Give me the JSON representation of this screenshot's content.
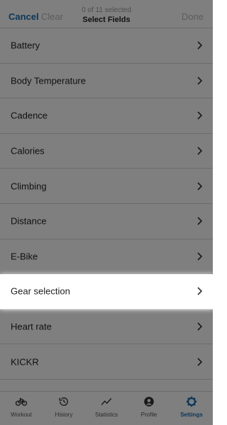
{
  "header": {
    "cancel_label": "Cancel",
    "clear_label": "Clear",
    "selected_count": "0 of 11 selected",
    "title": "Select Fields",
    "done_label": "Done"
  },
  "fields": [
    {
      "label": "Battery"
    },
    {
      "label": "Body Temperature"
    },
    {
      "label": "Cadence"
    },
    {
      "label": "Calories"
    },
    {
      "label": "Climbing"
    },
    {
      "label": "Distance"
    },
    {
      "label": "E-Bike"
    },
    {
      "label": "Gear selection"
    },
    {
      "label": "Heart rate"
    },
    {
      "label": "KICKR"
    }
  ],
  "highlighted_field": "Gear selection",
  "tabs": [
    {
      "label": "Workout",
      "icon": "bike-icon"
    },
    {
      "label": "History",
      "icon": "history-icon"
    },
    {
      "label": "Statistics",
      "icon": "statistics-icon"
    },
    {
      "label": "Profile",
      "icon": "profile-icon"
    },
    {
      "label": "Settings",
      "icon": "gear-icon",
      "active": true
    }
  ],
  "colors": {
    "accent": "#1a6fb5",
    "disabled": "#b9b9b9",
    "overlay": "rgba(0,0,0,0.5)"
  }
}
